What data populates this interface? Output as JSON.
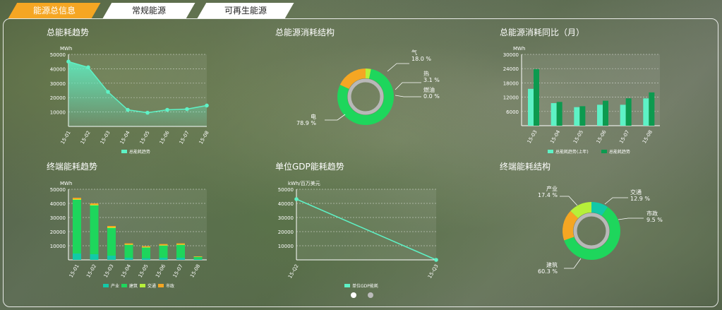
{
  "tabs": [
    {
      "label": "能源总信息"
    },
    {
      "label": "常规能源"
    },
    {
      "label": "可再生能源"
    }
  ],
  "panels": {
    "p1": {
      "title": "总能耗趋势",
      "unit": "MWh",
      "legend": "总能耗趋势"
    },
    "p2": {
      "title": "总能源消耗结构"
    },
    "p3": {
      "title": "总能源消耗同比（月）",
      "unit": "MWh",
      "legend": [
        "总能耗趋势(上年)",
        "总能耗趋势"
      ]
    },
    "p4": {
      "title": "终端能耗趋势",
      "unit": "MWh",
      "legend": [
        "产业",
        "建筑",
        "交通",
        "市政"
      ]
    },
    "p5": {
      "title": "单位GDP能耗趋势",
      "unit": "kWh/百万美元",
      "legend": "单位GDP能耗"
    },
    "p6": {
      "title": "终端能耗结构"
    }
  },
  "colors": {
    "accent": "#f5a623",
    "line": "#5ef2c6",
    "green": "#1ed65c",
    "dark_green": "#0c9a4f",
    "yellow": "#b6f03a",
    "teal": "#12c9a8"
  },
  "chart_data": [
    {
      "id": "p1",
      "type": "area",
      "categories": [
        "15-01",
        "15-02",
        "15-03",
        "15-04",
        "15-05",
        "15-06",
        "15-07",
        "15-08"
      ],
      "series": [
        {
          "name": "总能耗趋势",
          "values": [
            45000,
            41000,
            24000,
            11500,
            9500,
            11500,
            12000,
            14500
          ]
        }
      ],
      "ylim": [
        0,
        50000
      ],
      "yticks": [
        10000,
        20000,
        30000,
        40000,
        50000
      ],
      "ylabel": "MWh"
    },
    {
      "id": "p2",
      "type": "pie",
      "slices": [
        {
          "name": "电",
          "pct": "78.9 %",
          "value": 78.9,
          "color": "#1ed65c"
        },
        {
          "name": "气",
          "pct": "18.0 %",
          "value": 18.0,
          "color": "#f5a623"
        },
        {
          "name": "热",
          "pct": "3.1 %",
          "value": 3.1,
          "color": "#b6f03a"
        },
        {
          "name": "燃油",
          "pct": "0.0 %",
          "value": 0.0,
          "color": "#12c9a8"
        }
      ]
    },
    {
      "id": "p3",
      "type": "bar",
      "categories": [
        "15-03",
        "15-04",
        "15-05",
        "15-06",
        "15-07",
        "15-08"
      ],
      "series": [
        {
          "name": "总能耗趋势(上年)",
          "values": [
            15500,
            9500,
            7800,
            8800,
            8800,
            11500
          ]
        },
        {
          "name": "总能耗趋势",
          "values": [
            23800,
            10000,
            8200,
            10500,
            11500,
            14000
          ]
        }
      ],
      "ylim": [
        0,
        30000
      ],
      "yticks": [
        6000,
        12000,
        18000,
        24000,
        30000
      ],
      "ylabel": "MWh"
    },
    {
      "id": "p4",
      "type": "bar",
      "categories": [
        "15-01",
        "15-02",
        "15-03",
        "15-04",
        "15-05",
        "15-06",
        "15-07",
        "15-08"
      ],
      "series": [
        {
          "name": "产业",
          "values": [
            4500,
            4000,
            3000,
            1500,
            1200,
            1500,
            1500,
            500
          ]
        },
        {
          "name": "建筑",
          "values": [
            38000,
            34500,
            19500,
            9000,
            7500,
            8500,
            9000,
            1500
          ]
        },
        {
          "name": "交通",
          "values": [
            500,
            500,
            500,
            400,
            300,
            400,
            400,
            200
          ]
        },
        {
          "name": "市政",
          "values": [
            1000,
            1000,
            1000,
            800,
            700,
            800,
            800,
            300
          ]
        }
      ],
      "ylim": [
        0,
        50000
      ],
      "yticks": [
        10000,
        20000,
        30000,
        40000,
        50000
      ],
      "ylabel": "MWh"
    },
    {
      "id": "p5",
      "type": "line",
      "categories": [
        "15-Q2",
        "15-Q3"
      ],
      "series": [
        {
          "name": "单位GDP能耗",
          "values": [
            43000,
            0
          ]
        }
      ],
      "ylim": [
        0,
        50000
      ],
      "yticks": [
        10000,
        20000,
        30000,
        40000,
        50000
      ],
      "ylabel": "kWh/百万美元"
    },
    {
      "id": "p6",
      "type": "pie",
      "slices": [
        {
          "name": "建筑",
          "pct": "60.3 %",
          "value": 60.3,
          "color": "#1ed65c"
        },
        {
          "name": "产业",
          "pct": "17.4 %",
          "value": 17.4,
          "color": "#f5a623"
        },
        {
          "name": "交通",
          "pct": "12.9 %",
          "value": 12.9,
          "color": "#b6f03a"
        },
        {
          "name": "市政",
          "pct": "9.5 %",
          "value": 9.5,
          "color": "#12c9a8"
        }
      ]
    }
  ]
}
